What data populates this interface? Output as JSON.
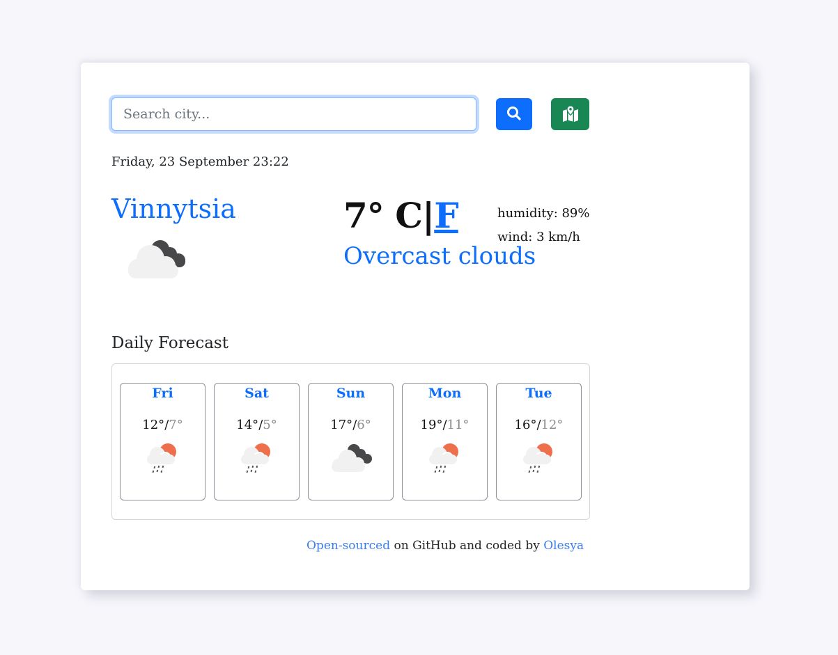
{
  "search": {
    "placeholder": "Search city...",
    "value": "",
    "search_button_icon": "search-icon",
    "location_button_icon": "map-location-icon"
  },
  "current": {
    "date": "Friday, 23 September 23:22",
    "city": "Vinnytsia",
    "icon": "overcast-clouds-icon",
    "temperature": "7°",
    "unit_c": "C",
    "separator": "|",
    "unit_f": "F",
    "description": "Overcast clouds",
    "humidity": "humidity: 89%",
    "wind": "wind: 3 km/h"
  },
  "forecast": {
    "title": "Daily Forecast",
    "days": [
      {
        "day": "Fri",
        "high": "12°",
        "low": "7°",
        "icon": "rain-sun-icon"
      },
      {
        "day": "Sat",
        "high": "14°",
        "low": "5°",
        "icon": "rain-sun-icon"
      },
      {
        "day": "Sun",
        "high": "17°",
        "low": "6°",
        "icon": "overcast-clouds-icon"
      },
      {
        "day": "Mon",
        "high": "19°",
        "low": "11°",
        "icon": "rain-sun-icon"
      },
      {
        "day": "Tue",
        "high": "16°",
        "low": "12°",
        "icon": "rain-sun-icon"
      }
    ]
  },
  "footer": {
    "link1": "Open-sourced",
    "middle": " on GitHub and coded by ",
    "link2": "Olesya"
  },
  "colors": {
    "accent": "#0d6efd",
    "location_button": "#198754",
    "sun": "#ee6f4c",
    "cloud_light": "#f1f1f1",
    "cloud_dark": "#48484a"
  }
}
